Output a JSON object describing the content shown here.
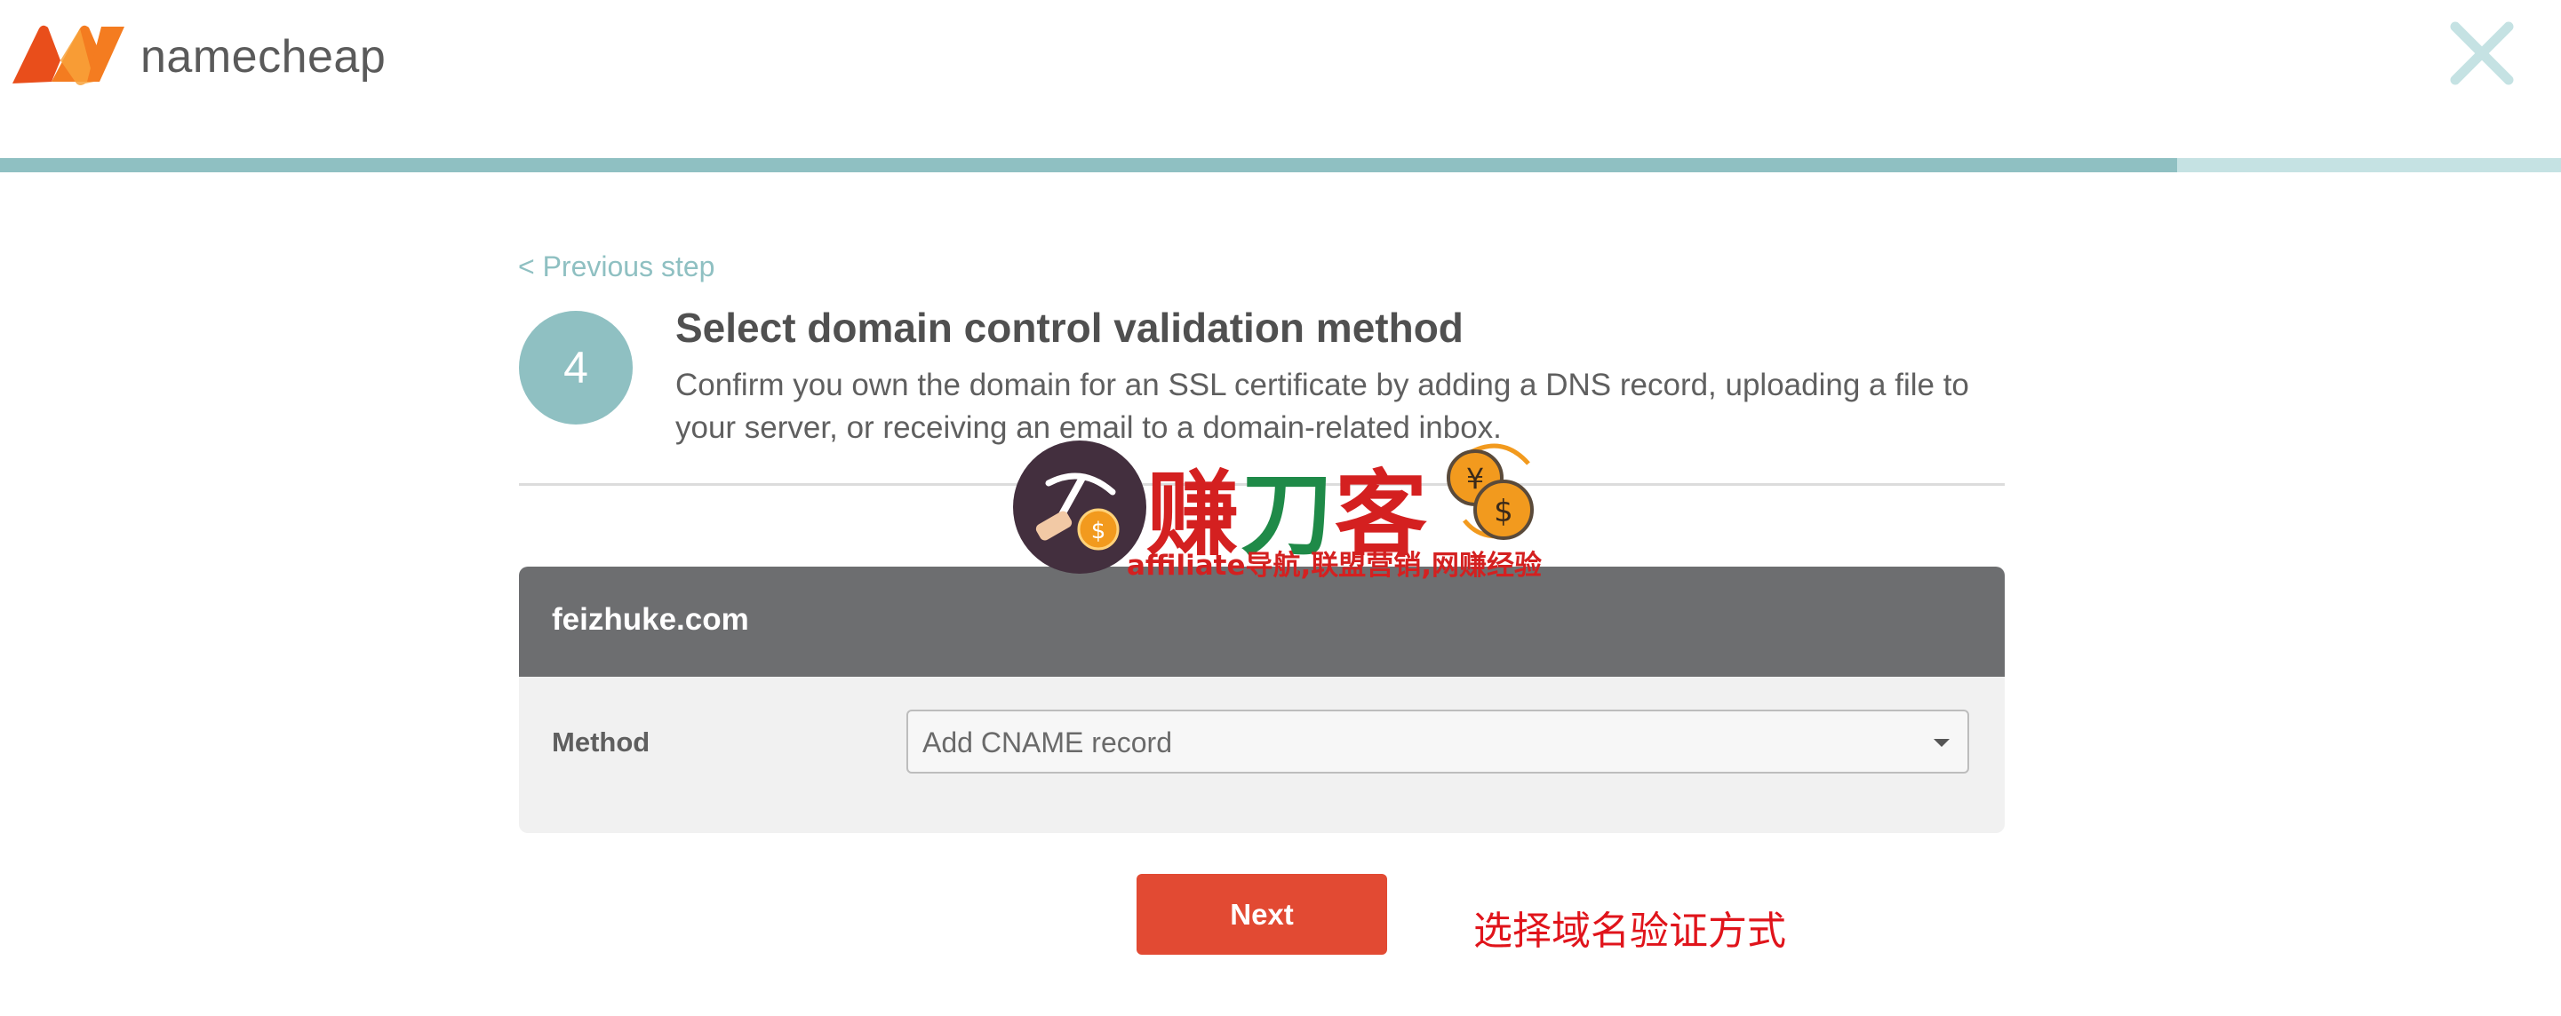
{
  "header": {
    "brand_name": "namecheap",
    "logo_icon": "namecheap-n-logo",
    "close_icon": "close-x",
    "brand_colors": {
      "logo_orange": "#f47c20",
      "logo_red": "#e94e1b",
      "close": "#c5e2e3"
    }
  },
  "progress": {
    "value_percent": 85,
    "fill_color": "#8fc0c2",
    "track_color": "#c5e2e3"
  },
  "step": {
    "previous_label": "< Previous step",
    "number": "4",
    "title": "Select domain control validation method",
    "description": "Confirm you own the domain for an SSL certificate by adding a DNS record, uploading a file to your server, or receiving an email to a domain-related inbox."
  },
  "panel": {
    "domain": "feizhuke.com",
    "method_label": "Method",
    "method_value": "Add CNAME record",
    "header_color": "#6d6e70",
    "body_color": "#f1f1f1"
  },
  "actions": {
    "next_label": "Next",
    "next_color": "#e24a33"
  },
  "annotation": {
    "text": "选择域名验证方式",
    "color": "#e0141b"
  },
  "watermark": {
    "title_chars": [
      "赚",
      "刀",
      "客"
    ],
    "subtitle": "affiliate导航,联盟营销,网赚经验",
    "icon": "pickaxe-coin-icon",
    "coins_icon": "yen-dollar-coins-icon"
  }
}
